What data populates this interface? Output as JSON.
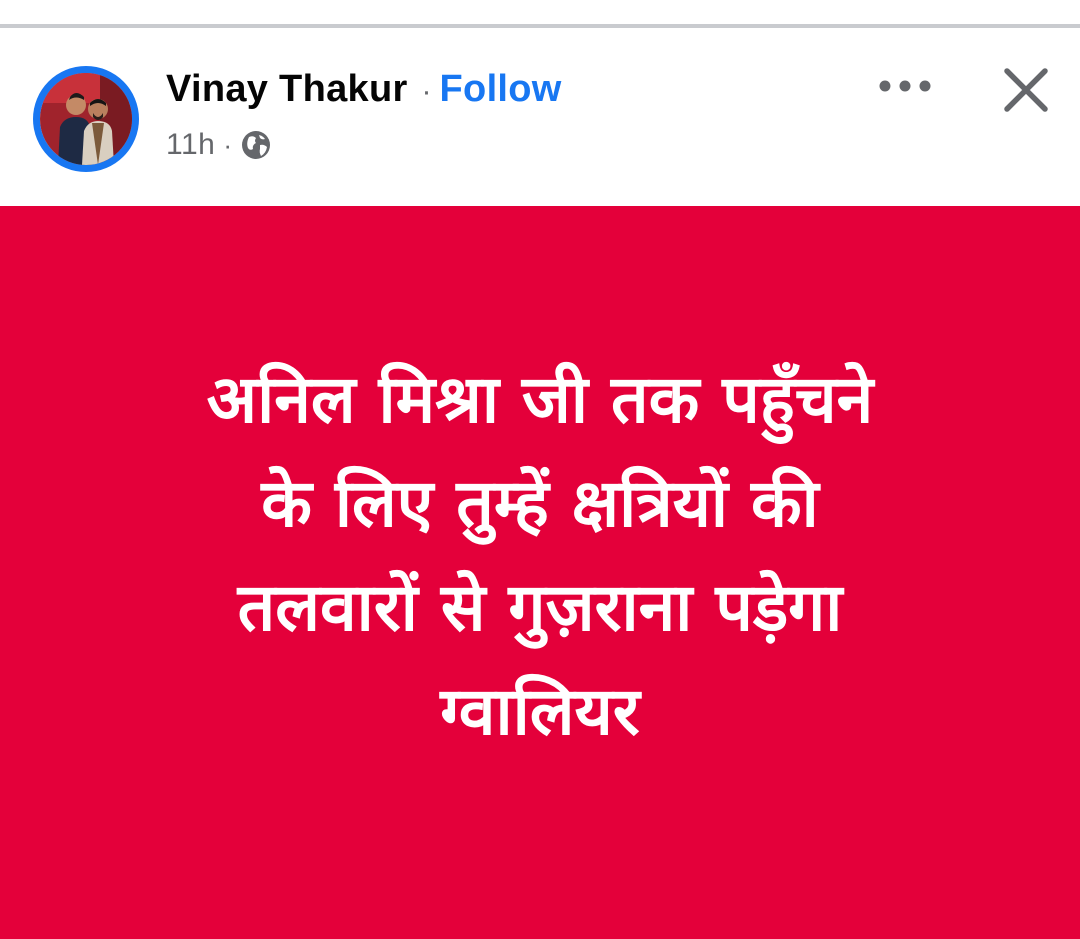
{
  "post": {
    "author": {
      "name": "Vinay Thakur",
      "follow_label": "Follow",
      "separator": "·",
      "avatar_icon": "profile-photo-avatar"
    },
    "meta": {
      "time": "11h",
      "separator": "·",
      "audience_icon": "globe-icon"
    },
    "actions": {
      "more_icon": "more-options-icon",
      "close_icon": "close-icon"
    },
    "card": {
      "background_color": "#e4003a",
      "text_color": "#ffffff",
      "lines": [
        "अनिल मिश्रा जी तक पहुँचने",
        "के लिए तुम्हें क्षत्रियों की",
        "तलवारों से गुज़राना पड़ेगा",
        "ग्वालियर"
      ]
    }
  },
  "colors": {
    "accent": "#1877f2",
    "secondary_text": "#65676b",
    "primary_text": "#050505"
  }
}
